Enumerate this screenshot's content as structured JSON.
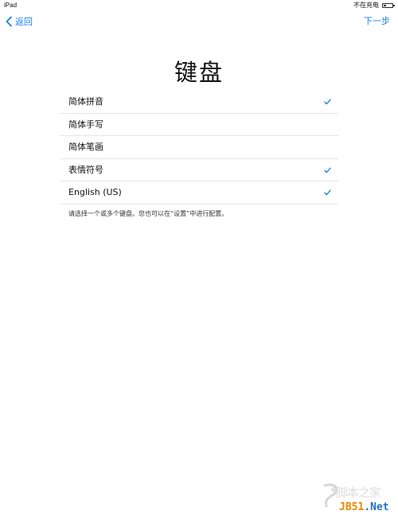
{
  "status_bar": {
    "device": "iPad",
    "charging_status": "不在充电",
    "battery_level": 0.3
  },
  "nav": {
    "back_label": "返回",
    "next_label": "下一步"
  },
  "page": {
    "title": "键盘"
  },
  "keyboards": [
    {
      "label": "简体拼音",
      "checked": true
    },
    {
      "label": "简体手写",
      "checked": false
    },
    {
      "label": "简体笔画",
      "checked": false
    },
    {
      "label": "表情符号",
      "checked": true
    },
    {
      "label": "English (US)",
      "checked": true
    }
  ],
  "footer_note": "请选择一个或多个键盘。您也可以在“设置”中进行配置。",
  "watermark": {
    "top": "脚本之家",
    "jb": "JB51",
    "net": ".Net"
  },
  "colors": {
    "accent": "#1a82e4",
    "separator": "#e6e6e6",
    "watermark_orange": "#e88800",
    "watermark_blue": "#1f6fc5"
  }
}
